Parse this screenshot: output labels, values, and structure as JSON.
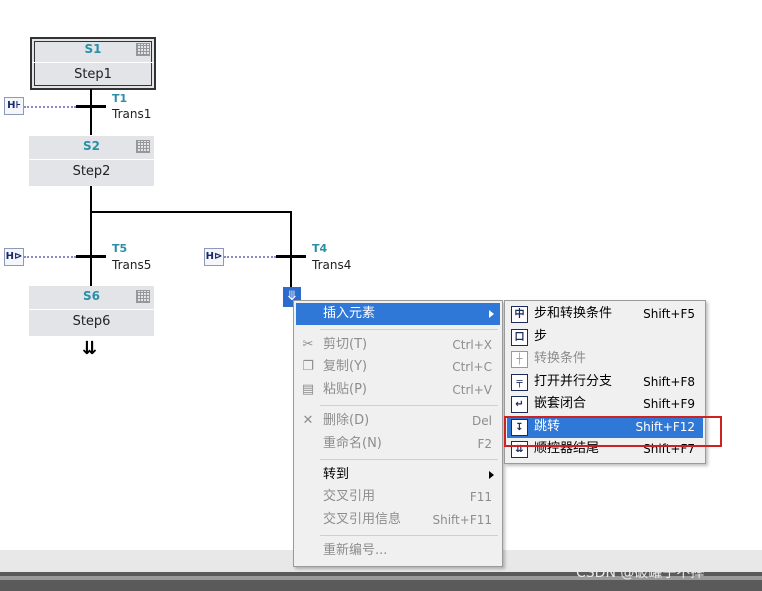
{
  "steps": [
    {
      "num": "S1",
      "name": "Step1"
    },
    {
      "num": "S2",
      "name": "Step2"
    },
    {
      "num": "S6",
      "name": "Step6"
    }
  ],
  "transitions": [
    {
      "id": "T1",
      "name": "Trans1"
    },
    {
      "id": "T5",
      "name": "Trans5"
    },
    {
      "id": "T4",
      "name": "Trans4"
    }
  ],
  "context_menu": {
    "items": [
      {
        "label": "插入元素",
        "shortcut": "",
        "has_submenu": true
      },
      {
        "label": "剪切(T)",
        "shortcut": "Ctrl+X"
      },
      {
        "label": "复制(Y)",
        "shortcut": "Ctrl+C"
      },
      {
        "label": "粘贴(P)",
        "shortcut": "Ctrl+V"
      },
      {
        "label": "删除(D)",
        "shortcut": "Del"
      },
      {
        "label": "重命名(N)",
        "shortcut": "F2"
      },
      {
        "label": "转到",
        "shortcut": "",
        "has_submenu": true
      },
      {
        "label": "交叉引用",
        "shortcut": "F11"
      },
      {
        "label": "交叉引用信息",
        "shortcut": "Shift+F11"
      },
      {
        "label": "重新编号...",
        "shortcut": ""
      }
    ]
  },
  "submenu": {
    "items": [
      {
        "label": "步和转换条件",
        "shortcut": "Shift+F5"
      },
      {
        "label": "步",
        "shortcut": ""
      },
      {
        "label": "转换条件",
        "shortcut": ""
      },
      {
        "label": "打开并行分支",
        "shortcut": "Shift+F8"
      },
      {
        "label": "嵌套闭合",
        "shortcut": "Shift+F9"
      },
      {
        "label": "跳转",
        "shortcut": "Shift+F12"
      },
      {
        "label": "顺控器结尾",
        "shortcut": "Shift+F7"
      }
    ]
  },
  "watermark": "CSDN @破罐子不摔",
  "colors": {
    "accent": "#2b8fa6",
    "highlight": "#3078d8",
    "annotation": "#cc2222"
  }
}
